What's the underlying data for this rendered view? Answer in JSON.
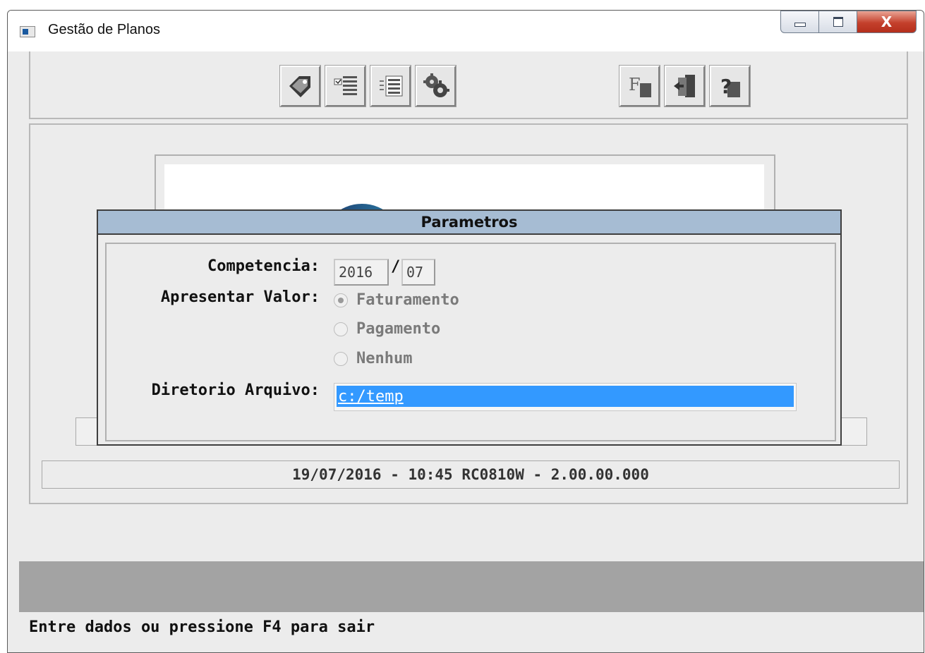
{
  "window": {
    "title": "Gestão de Planos",
    "close_glyph": "X"
  },
  "toolbar": {
    "left_buttons": [
      "tag-icon",
      "checklist-icon",
      "list-icon",
      "gears-icon"
    ],
    "right_buttons": [
      "f-icon",
      "exit-door-icon",
      "help-icon"
    ]
  },
  "status_line": "19/07/2016 - 10:45   RC0810W - 2.00.00.000",
  "message": "Entre dados ou pressione F4 para sair",
  "dialog": {
    "title": "Parametros",
    "competencia_label": "Competencia:",
    "year": "2016",
    "separator": "/",
    "month": "07",
    "apresentar_label": "Apresentar Valor:",
    "options": [
      {
        "label": "Faturamento",
        "selected": true
      },
      {
        "label": "Pagamento",
        "selected": false
      },
      {
        "label": "Nenhum",
        "selected": false
      }
    ],
    "diretorio_label": "Diretorio Arquivo:",
    "diretorio_value": "c:/temp"
  },
  "colors": {
    "dialog_title_bg": "#a6bcd3",
    "selection": "#3399ff",
    "close_button": "#c4402c"
  }
}
